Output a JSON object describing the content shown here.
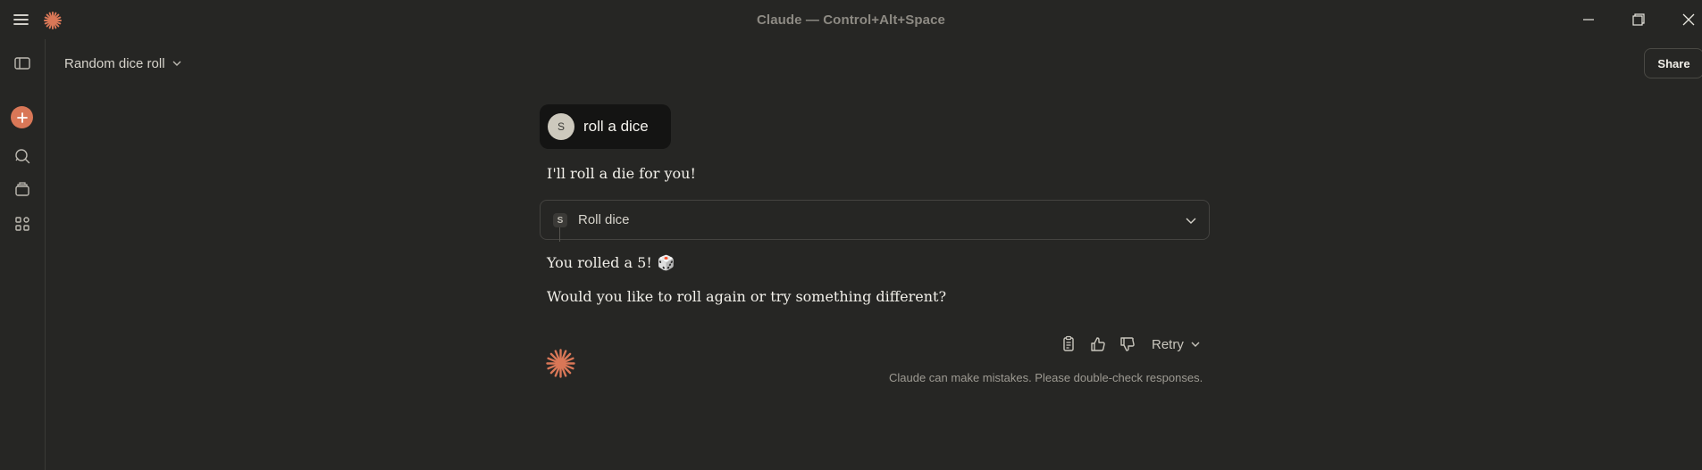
{
  "window": {
    "title": "Claude — Control+Alt+Space"
  },
  "header": {
    "chat_title": "Random dice roll",
    "share_label": "Share"
  },
  "sidebar": {
    "icons": [
      "sidebar-toggle-icon",
      "new-chat-icon",
      "chat-search-icon",
      "projects-icon",
      "artifacts-icon"
    ]
  },
  "conversation": {
    "user": {
      "avatar_initial": "S",
      "message": "roll a dice"
    },
    "assistant": {
      "intro": "I'll roll a die for you!",
      "tool": {
        "badge": "S",
        "label": "Roll dice"
      },
      "result": "You rolled a 5!",
      "result_emoji": "🎲",
      "followup": "Would you like to roll again or try something different?"
    },
    "actions": {
      "retry_label": "Retry"
    },
    "disclaimer": "Claude can make mistakes. Please double-check responses."
  },
  "colors": {
    "background": "#262624",
    "accent": "#d97757",
    "user_bubble": "#141413"
  }
}
